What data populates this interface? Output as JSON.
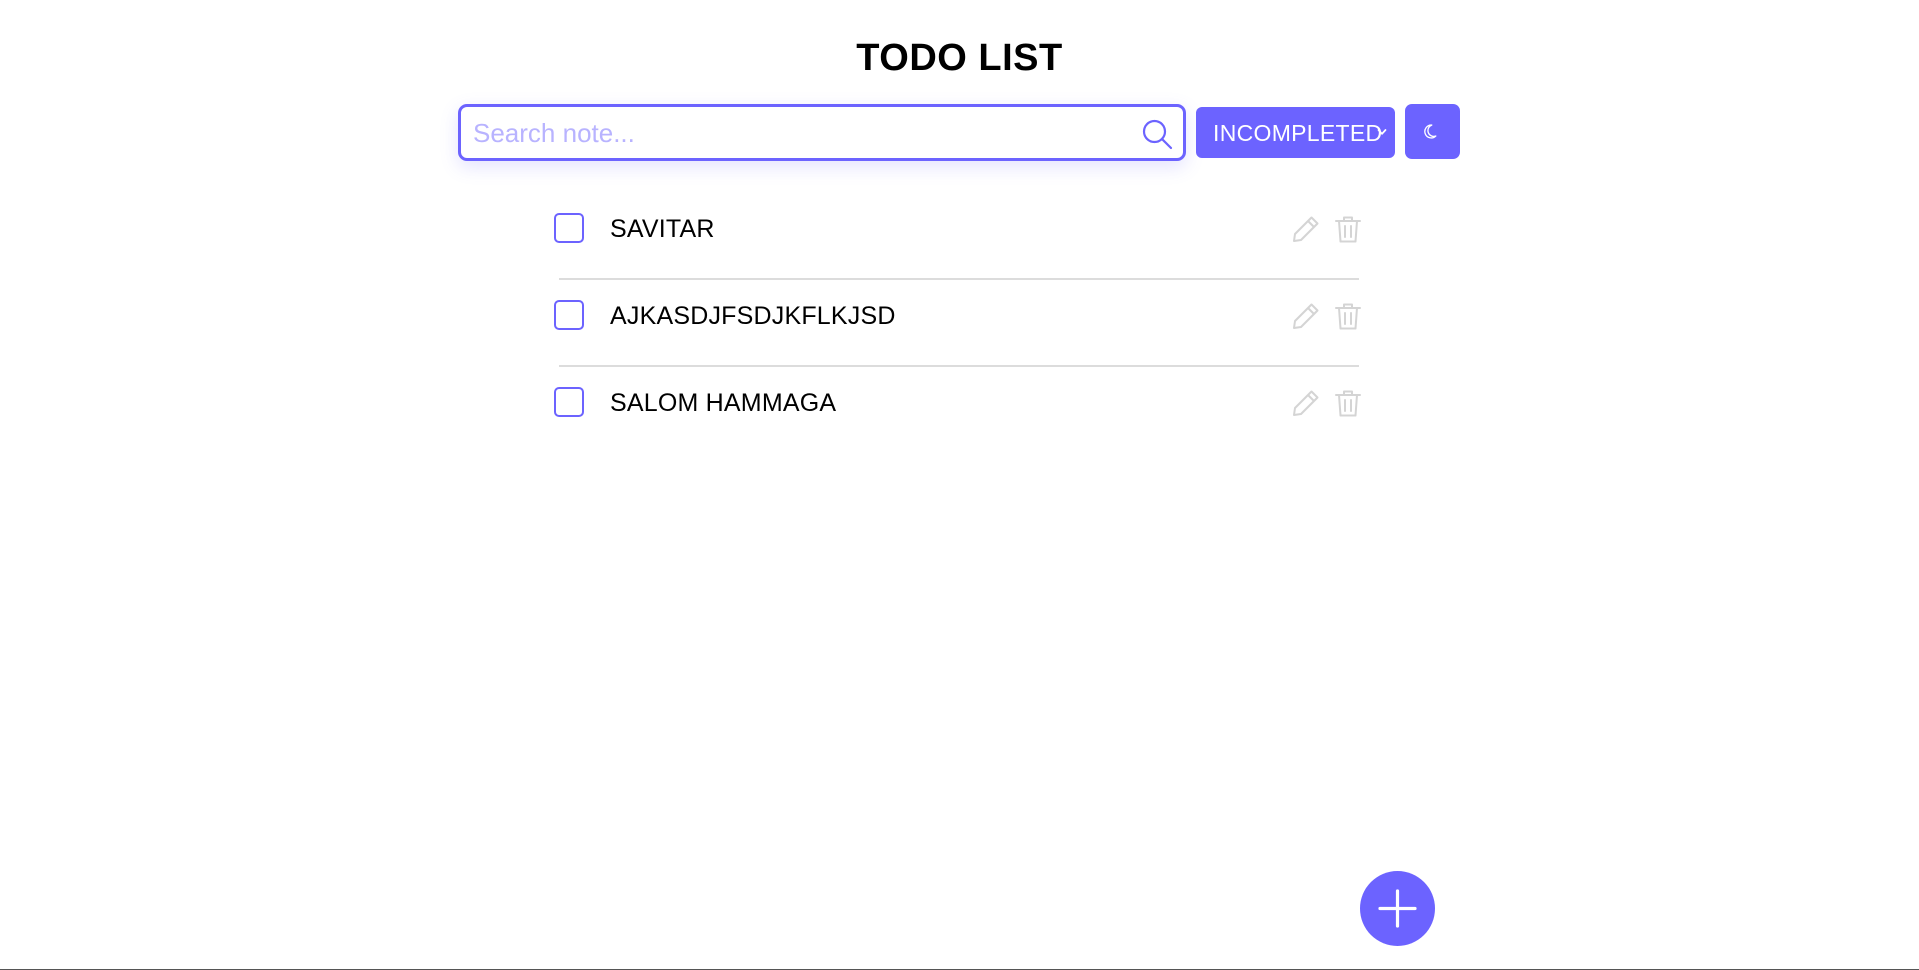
{
  "app": {
    "title": "TODO LIST"
  },
  "search": {
    "placeholder": "Search note...",
    "value": "",
    "icon": "search-icon"
  },
  "filter": {
    "selected": "INCOMPLETED",
    "icon": "chevron-down-icon"
  },
  "theme_toggle": {
    "icon": "moon-icon"
  },
  "todos": [
    {
      "label": "SAVITAR",
      "checked": false
    },
    {
      "label": "AJKASDJFSDJKFLKJSD",
      "checked": false
    },
    {
      "label": "SALOM HAMMAGA",
      "checked": false
    }
  ],
  "item_actions": {
    "edit_icon": "pencil-icon",
    "delete_icon": "trash-icon"
  },
  "add_button": {
    "icon": "plus-icon"
  },
  "colors": {
    "accent": "#6c63ff",
    "placeholder": "#b8b3ff",
    "action_icon": "#d4d4d4",
    "divider": "#dcdcdc",
    "text": "#000000",
    "background": "#ffffff"
  }
}
